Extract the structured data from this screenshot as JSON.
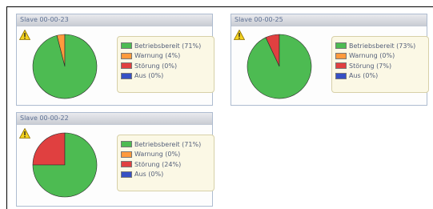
{
  "colors": {
    "green": "#4dbb52",
    "orange": "#ff9a3d",
    "red": "#e04040",
    "blue": "#3650c4"
  },
  "panels": [
    {
      "title": "Slave 00-00-23",
      "slices": [
        {
          "label": "Betriebsbereit (71%)",
          "value": 96,
          "color": "#4dbb52"
        },
        {
          "label": "Warnung (4%)",
          "value": 4,
          "color": "#ff9a3d"
        },
        {
          "label": "Störung (0%)",
          "value": 0,
          "color": "#e04040"
        },
        {
          "label": "Aus (0%)",
          "value": 0,
          "color": "#3650c4"
        }
      ]
    },
    {
      "title": "Slave 00-00-25",
      "slices": [
        {
          "label": "Betriebsbereit (73%)",
          "value": 93,
          "color": "#4dbb52"
        },
        {
          "label": "Warnung (0%)",
          "value": 0,
          "color": "#ff9a3d"
        },
        {
          "label": "Störung (7%)",
          "value": 7,
          "color": "#e04040"
        },
        {
          "label": "Aus (0%)",
          "value": 0,
          "color": "#3650c4"
        }
      ]
    },
    {
      "title": "Slave 00-00-22",
      "slices": [
        {
          "label": "Betriebsbereit (71%)",
          "value": 75,
          "color": "#4dbb52"
        },
        {
          "label": "Warnung (0%)",
          "value": 0,
          "color": "#ff9a3d"
        },
        {
          "label": "Störung (24%)",
          "value": 25,
          "color": "#e04040"
        },
        {
          "label": "Aus (0%)",
          "value": 0,
          "color": "#3650c4"
        }
      ]
    }
  ]
}
